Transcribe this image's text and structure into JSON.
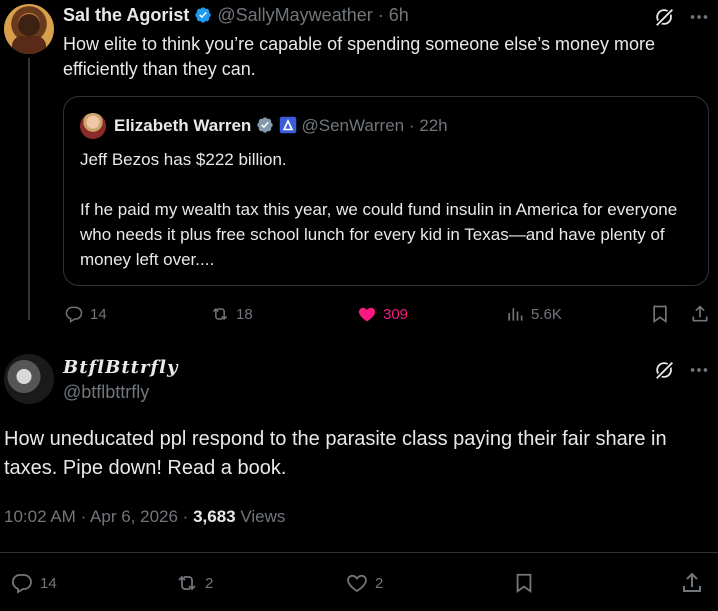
{
  "parent_tweet": {
    "author_name": "Sal the Agorist",
    "handle": "@SallyMayweather",
    "dot": "·",
    "time": "6h",
    "text": "How elite to think you’re capable of spending someone else’s money more efficiently than they can.",
    "quoted": {
      "author_name": "Elizabeth Warren",
      "handle": "@SenWarren",
      "dot": "·",
      "time": "22h",
      "text_1": "Jeff Bezos has $222 billion.",
      "text_2": "If he paid my wealth tax this year, we could fund insulin in America for everyone who needs it plus free school lunch for every kid in Texas—and have plenty of money left over...."
    },
    "actions": {
      "replies": "14",
      "reposts": "18",
      "likes": "309",
      "views": "5.6K"
    },
    "colors": {
      "like_active": "#f91880"
    }
  },
  "main_tweet": {
    "author_name": "𝑩𝒕𝒇𝒍𝑩𝒕𝒕𝒓𝒇𝒍𝒚",
    "handle": "@btflbttrfly",
    "text": "How uneducated ppl respond to the parasite class paying their fair share in taxes. Pipe down! Read a book.",
    "time": "10:02 AM",
    "date": "Apr 6, 2026",
    "dot": "·",
    "views_count": "3,683",
    "views_label": "Views",
    "actions": {
      "replies": "14",
      "reposts": "2",
      "likes": "2"
    }
  },
  "icons": [
    "verified-badge-icon",
    "grok-icon",
    "more-icon",
    "reply-icon",
    "repost-icon",
    "like-icon",
    "views-icon",
    "bookmark-icon",
    "share-icon",
    "government-badge-icon"
  ]
}
